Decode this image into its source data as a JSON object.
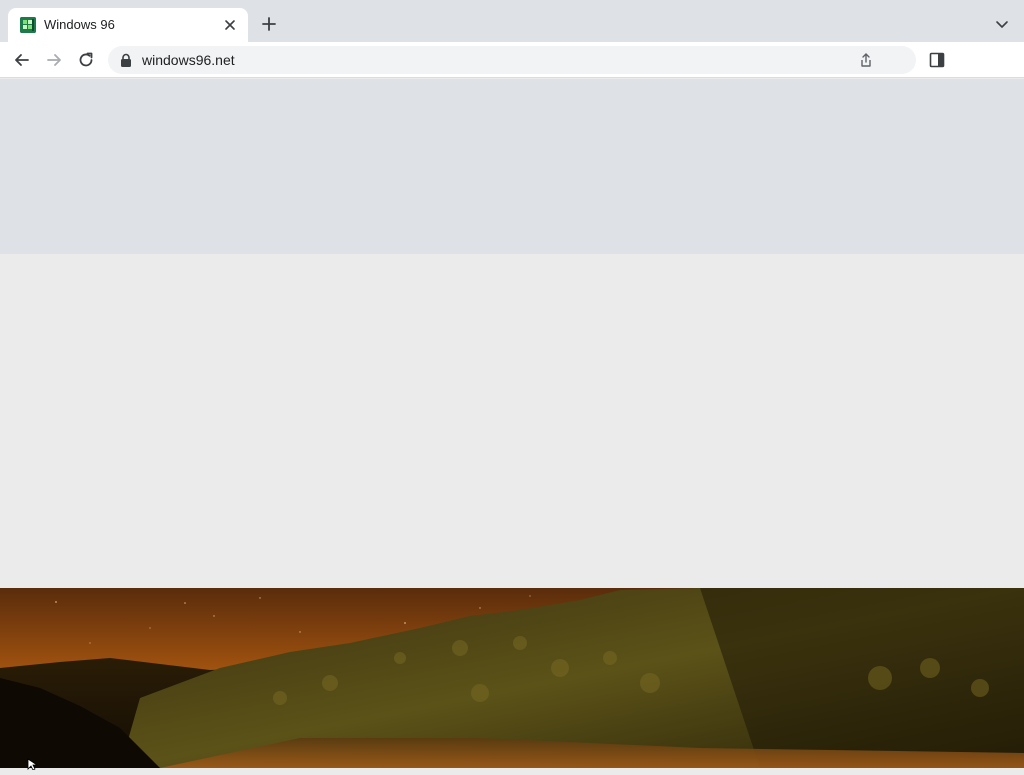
{
  "browser": {
    "tab": {
      "title": "Windows 96",
      "favicon": "windows96-logo-icon"
    },
    "address": {
      "url": "windows96.net",
      "secure_icon": "lock-icon"
    },
    "icons": {
      "close": "close-icon",
      "new_tab": "plus-icon",
      "tab_search": "chevron-down-icon",
      "back": "arrow-left-icon",
      "forward": "arrow-right-icon",
      "reload": "reload-icon",
      "share": "share-icon",
      "side_panel": "side-panel-icon"
    }
  },
  "colors": {
    "tabstrip": "#dee1e6",
    "toolbar": "#ffffff",
    "omnibox": "#f1f3f4",
    "page_top": "#dee1e6",
    "page_mid": "#ebebeb",
    "favicon": "#1e7a4a"
  }
}
